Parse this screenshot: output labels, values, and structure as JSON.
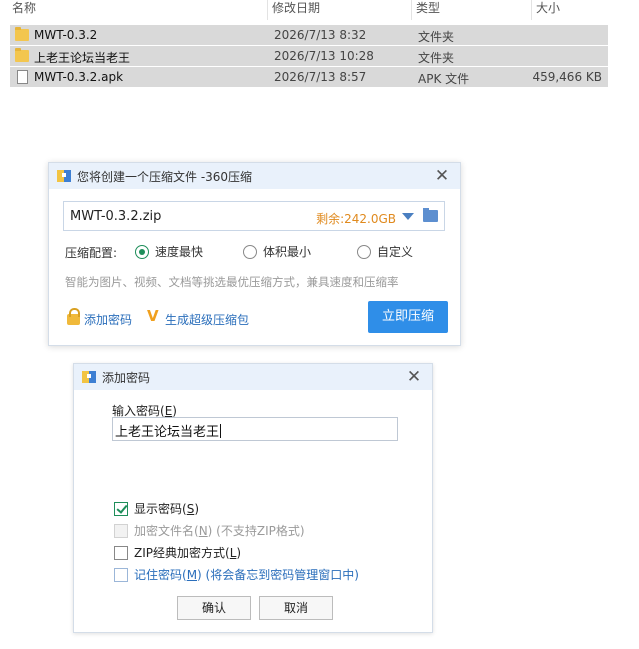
{
  "file_list": {
    "columns": [
      {
        "label": "名称"
      },
      {
        "label": "修改日期"
      },
      {
        "label": "类型"
      },
      {
        "label": "大小"
      }
    ],
    "rows": [
      {
        "icon": "folder-icon",
        "name": "MWT-0.3.2",
        "date": "2026/7/13 8:32",
        "type": "文件夹",
        "size": ""
      },
      {
        "icon": "folder-icon",
        "name": "上老王论坛当老王",
        "date": "2026/7/13 10:28",
        "type": "文件夹",
        "size": ""
      },
      {
        "icon": "file-icon",
        "name": "MWT-0.3.2.apk",
        "date": "2026/7/13 8:57",
        "type": "APK 文件",
        "size": "459,466 KB"
      }
    ]
  },
  "compress_dialog": {
    "title": "您将创建一个压缩文件 -360压缩",
    "filename": "MWT-0.3.2.zip",
    "remaining": "剩余:242.0GB",
    "config_label": "压缩配置:",
    "options": [
      "速度最快",
      "体积最小",
      "自定义"
    ],
    "selected_option": "速度最快",
    "hint": "智能为图片、视频、文档等挑选最优压缩方式，兼具速度和压缩率",
    "add_password": "添加密码",
    "super_package": "生成超级压缩包",
    "compress_now": "立即压缩",
    "accent_color": "#2f8ee8"
  },
  "password_dialog": {
    "title": "添加密码",
    "input_label": "输入密码(",
    "input_label_key": "E",
    "input_label_end": ")",
    "password_value": "上老王论坛当老王",
    "show_password": {
      "label": "显示密码(",
      "key": "S",
      "end": ")",
      "checked": true
    },
    "encrypt_filenames": {
      "label": "加密文件名(",
      "key": "N",
      "end": ") (不支持ZIP格式)",
      "checked": false,
      "disabled": true
    },
    "zip_classic": {
      "label": "ZIP经典加密方式(",
      "key": "L",
      "end": ")",
      "checked": false
    },
    "remember_password": {
      "label": "记住密码(",
      "key": "M",
      "end": ") (将会备忘到密码管理窗口中)",
      "checked": false
    },
    "ok": "确认",
    "cancel": "取消"
  }
}
